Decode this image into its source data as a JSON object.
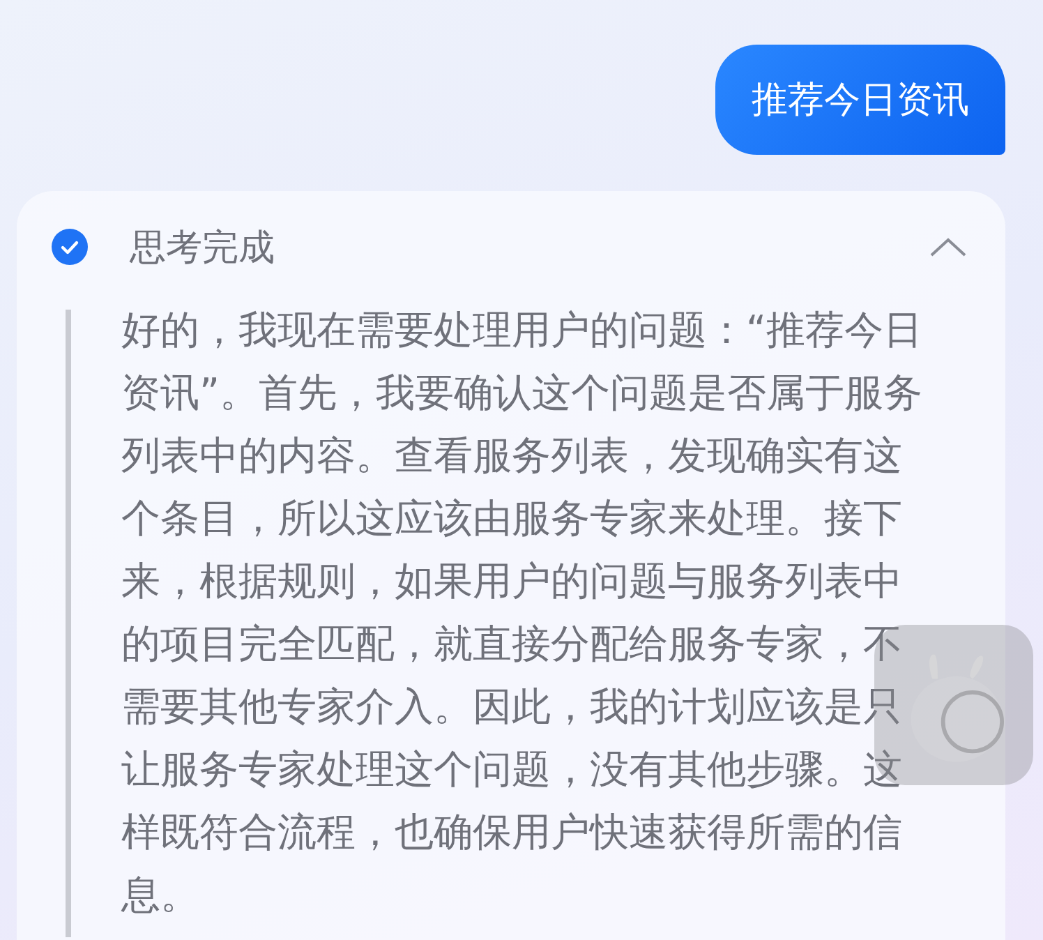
{
  "user_message": {
    "text": "推荐今日资讯"
  },
  "thinking": {
    "status": "思考完成",
    "done": true,
    "expanded": true,
    "text": "好的，我现在需要处理用户的问题：“推荐今日资讯”。首先，我要确认这个问题是否属于服务列表中的内容。查看服务列表，发现确实有这个条目，所以这应该由服务专家来处理。接下来，根据规则，如果用户的问题与服务列表中的项目完全匹配，就直接分配给服务专家，不需要其他专家介入。因此，我的计划应该是只让服务专家处理这个问题，没有其他步骤。这样既符合流程，也确保用户快速获得所需的信息。"
  }
}
